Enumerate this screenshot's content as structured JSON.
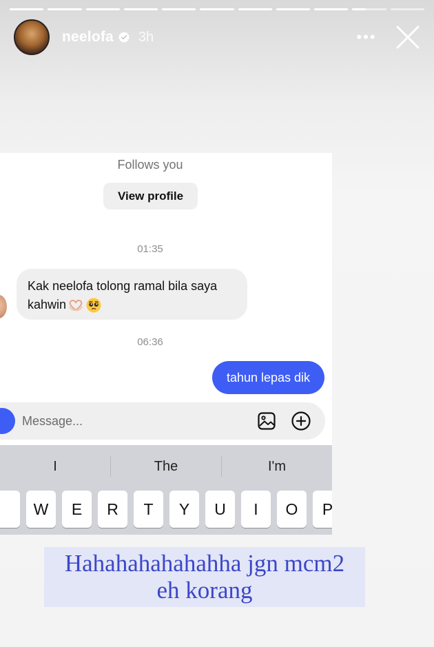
{
  "story": {
    "progress": {
      "segments": 11,
      "current_segment_fraction": 0.4,
      "completed_segments": 9
    },
    "username": "neelofa",
    "verified": true,
    "time_ago": "3h",
    "more_label": "•••",
    "icons": {
      "more": "more-horizontal-icon",
      "close": "close-x-icon",
      "verified": "verified-badge-icon"
    }
  },
  "dm": {
    "follows_you": "Follows you",
    "view_profile": "View profile",
    "timestamps": [
      "01:35",
      "06:36"
    ],
    "incoming_message": {
      "line1": "Kak neelofa tolong ramal bila saya",
      "line2": "kahwin",
      "emoji_names": [
        "heart-hands-emoji",
        "pleading-face-emoji"
      ]
    },
    "outgoing_message": "tahun lepas dik",
    "composer": {
      "placeholder": "Message...",
      "icons": [
        "camera-icon",
        "gallery-icon",
        "add-circle-icon"
      ]
    },
    "colors": {
      "outgoing_bubble": "#3e5df4",
      "incoming_bubble": "#efefef"
    }
  },
  "keyboard": {
    "suggestions": [
      "I",
      "The",
      "I'm"
    ],
    "keys": [
      "W",
      "E",
      "R",
      "T",
      "Y",
      "U",
      "I",
      "O",
      "P"
    ]
  },
  "caption": {
    "line1": "Hahahahahahahha jgn mcm2",
    "line2": "eh korang",
    "color": "#3c46c9"
  }
}
